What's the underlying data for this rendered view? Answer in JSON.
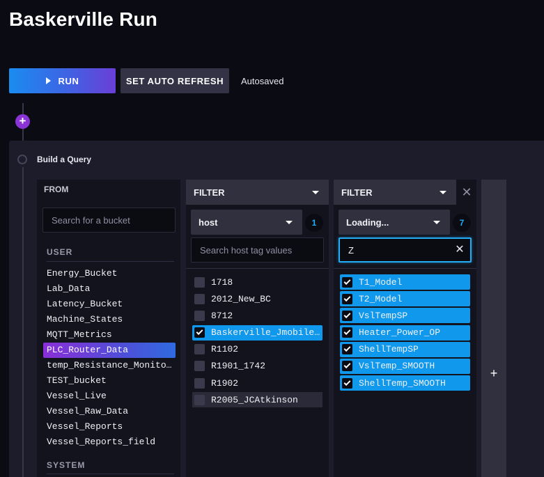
{
  "page": {
    "title": "Baskerville Run"
  },
  "toolbar": {
    "run_label": "RUN",
    "auto_refresh_label": "SET AUTO REFRESH",
    "status": "Autosaved"
  },
  "timeline": {
    "add_label": "+"
  },
  "query_builder": {
    "title": "Build a Query",
    "from": {
      "header": "FROM",
      "search_placeholder": "Search for a bucket",
      "sections": {
        "user": "USER",
        "system": "SYSTEM"
      },
      "buckets": [
        "Energy_Bucket",
        "Lab_Data",
        "Latency_Bucket",
        "Machine_States",
        "MQTT_Metrics",
        "PLC_Router_Data",
        "temp_Resistance_Monito…",
        "TEST_bucket",
        "Vessel_Live",
        "Vessel_Raw_Data",
        "Vessel_Reports",
        "Vessel_Reports_field"
      ],
      "selected_bucket": "PLC_Router_Data"
    },
    "filters": [
      {
        "header": "FILTER",
        "key": "host",
        "selected_count": "1",
        "search_placeholder": "Search host tag values",
        "search_value": "",
        "values": [
          {
            "label": "1718",
            "checked": false
          },
          {
            "label": "2012_New_BC",
            "checked": false
          },
          {
            "label": "8712",
            "checked": false
          },
          {
            "label": "Baskerville_Jmobile…",
            "checked": true
          },
          {
            "label": "R1102",
            "checked": false
          },
          {
            "label": "R1901_1742",
            "checked": false
          },
          {
            "label": "R1902",
            "checked": false
          },
          {
            "label": "R2005_JCAtkinson",
            "checked": false,
            "hover": true
          }
        ]
      },
      {
        "header": "FILTER",
        "key": "Loading...",
        "selected_count": "7",
        "search_placeholder": "",
        "search_value": "Z",
        "values": [
          {
            "label": "T1_Model",
            "checked": true
          },
          {
            "label": "T2_Model",
            "checked": true
          },
          {
            "label": "VslTempSP",
            "checked": true
          },
          {
            "label": "Heater_Power_OP",
            "checked": true
          },
          {
            "label": "ShellTempSP",
            "checked": true
          },
          {
            "label": "VslTemp_SMOOTH",
            "checked": true
          },
          {
            "label": "ShellTemp_SMOOTH",
            "checked": true
          }
        ]
      }
    ],
    "add_filter_label": "+"
  },
  "icons": {
    "run": "play-icon",
    "caret": "chevron-down-icon",
    "close": "close-icon",
    "clear": "clear-icon",
    "check": "check-icon"
  },
  "colors": {
    "background": "#0b0b14",
    "panel": "#1c1c2a",
    "accent_blue": "#0f98ec",
    "accent_purple": "#8b34d6"
  }
}
